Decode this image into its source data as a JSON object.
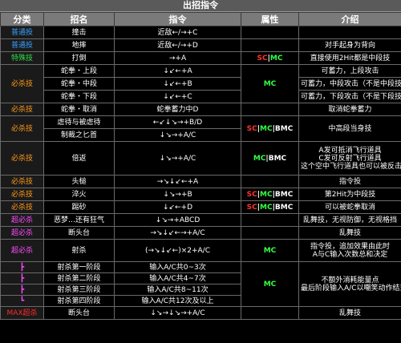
{
  "title": "出招指令",
  "headers": [
    "分类",
    "招名",
    "指令",
    "属性",
    "介绍"
  ],
  "colors": {
    "title_bg": "#5a5a5a",
    "header_bg": "#7a7a7a",
    "normal_move": "#3aa0ff",
    "special_command": "#2fe04a",
    "special_move": "#ff9a1a",
    "super_move": "#ff4bff",
    "max_super": "#ff2a2a",
    "sc_attr": "#ff3333",
    "mc_attr": "#33ff44"
  },
  "rows": [
    {
      "cat": "普通投",
      "name": "撞击",
      "cmd": "近敌←/→+C"
    },
    {
      "cat": "普通投",
      "name": "地摔",
      "cmd": "近敌←/→+D",
      "desc": "对手起身为背向"
    },
    {
      "cat": "特殊技",
      "name": "打倒",
      "cmd": "→+A",
      "attr_sc": "SC",
      "attr_sep": "|",
      "attr_mc": "MC",
      "desc": "直接使用2Hit都是中段技"
    },
    {
      "cat": "必杀技",
      "name": "蛇拳・上段",
      "cmd": "↓↙←+A",
      "attr": "MC",
      "desc": "可蓄力，上段攻击"
    },
    {
      "name": "蛇拳・中段",
      "cmd": "↓↙←+B",
      "desc": "可蓄力，中段攻击（不是中段技）"
    },
    {
      "name": "蛇拳・下段",
      "cmd": "↓↙←+C",
      "desc": "可蓄力，下段攻击（不是下段技）"
    },
    {
      "cat": "必杀技",
      "name": "蛇拳・取消",
      "cmd": "蛇拳蓄力中D",
      "desc": "取消蛇拳蓄力"
    },
    {
      "cat": "必杀技",
      "name": "虐待与被虐待",
      "cmd": "←↙↓↘→+B/D",
      "attr_sc": "SC",
      "attr_sep1": "|",
      "attr_mc": "MC",
      "attr_sep2": "|",
      "attr_bmc": "BMC",
      "desc": "中高段当身技"
    },
    {
      "name": "制裁之匕首",
      "cmd": "↓↘→+A/C"
    },
    {
      "cat": "必杀技",
      "name": "倍返",
      "cmd": "↓↘→+A/C",
      "attr_mc": "MC",
      "attr_sep": "|",
      "attr_bmc": "BMC",
      "desc1": "A发可抵消飞行道具",
      "desc2": "C发可反射飞行道具",
      "desc3": "这个空中飞行道具也可以被反击"
    },
    {
      "cat": "必杀技",
      "name": "头槌",
      "cmd": "→↘↓↙←+A",
      "desc": "指令投"
    },
    {
      "cat": "必杀技",
      "name": "淬火",
      "cmd": "↓↘→+B",
      "attr_sc": "SC",
      "attr_sep1": "|",
      "attr_mc": "MC",
      "attr_sep2": "|",
      "attr_bmc": "BMC",
      "desc": "第2Hit为中段技"
    },
    {
      "cat": "必杀技",
      "name": "踢砂",
      "cmd": "↓↙←+D",
      "attr_sc": "SC",
      "attr_sep1": "|",
      "attr_mc": "MC",
      "attr_sep2": "|",
      "attr_bmc": "BMC",
      "desc": "可以被蛇拳取消"
    },
    {
      "cat": "超必杀",
      "name": "恶梦…还有狂气",
      "cmd": "↓↘→+ABCD",
      "desc": "乱舞技，无视防御，无视格挡"
    },
    {
      "cat": "超必杀",
      "name": "断头台",
      "cmd": "→↘↓↙←→+A/C",
      "desc": "乱舞技"
    },
    {
      "cat": "超必杀",
      "name": "射杀",
      "cmd": "(→↘↓↙←)×2+A/C",
      "attr": "MC",
      "desc1": "指令投，追加效果由此时",
      "desc2": "A与C输入次数总和决定"
    },
    {
      "cat": "┣",
      "name": "射杀第一阶段",
      "cmd": "输入A/C共0~3次",
      "attr": "MC",
      "desc1": "不额外消耗能量点",
      "desc2": "最后阶段输入A/C以嘲笑动作结束"
    },
    {
      "cat": "┣",
      "name": "射杀第二阶段",
      "cmd": "输入A/C共4~7次"
    },
    {
      "cat": "┣",
      "name": "射杀第三阶段",
      "cmd": "输入A/C共8~11次"
    },
    {
      "cat": "┗",
      "name": "射杀第四阶段",
      "cmd": "输入A/C共12次及以上"
    },
    {
      "cat": "MAX超杀",
      "name": "断头台",
      "cmd": "↓↘→↓↘→+A/C",
      "desc": "乱舞技"
    }
  ]
}
